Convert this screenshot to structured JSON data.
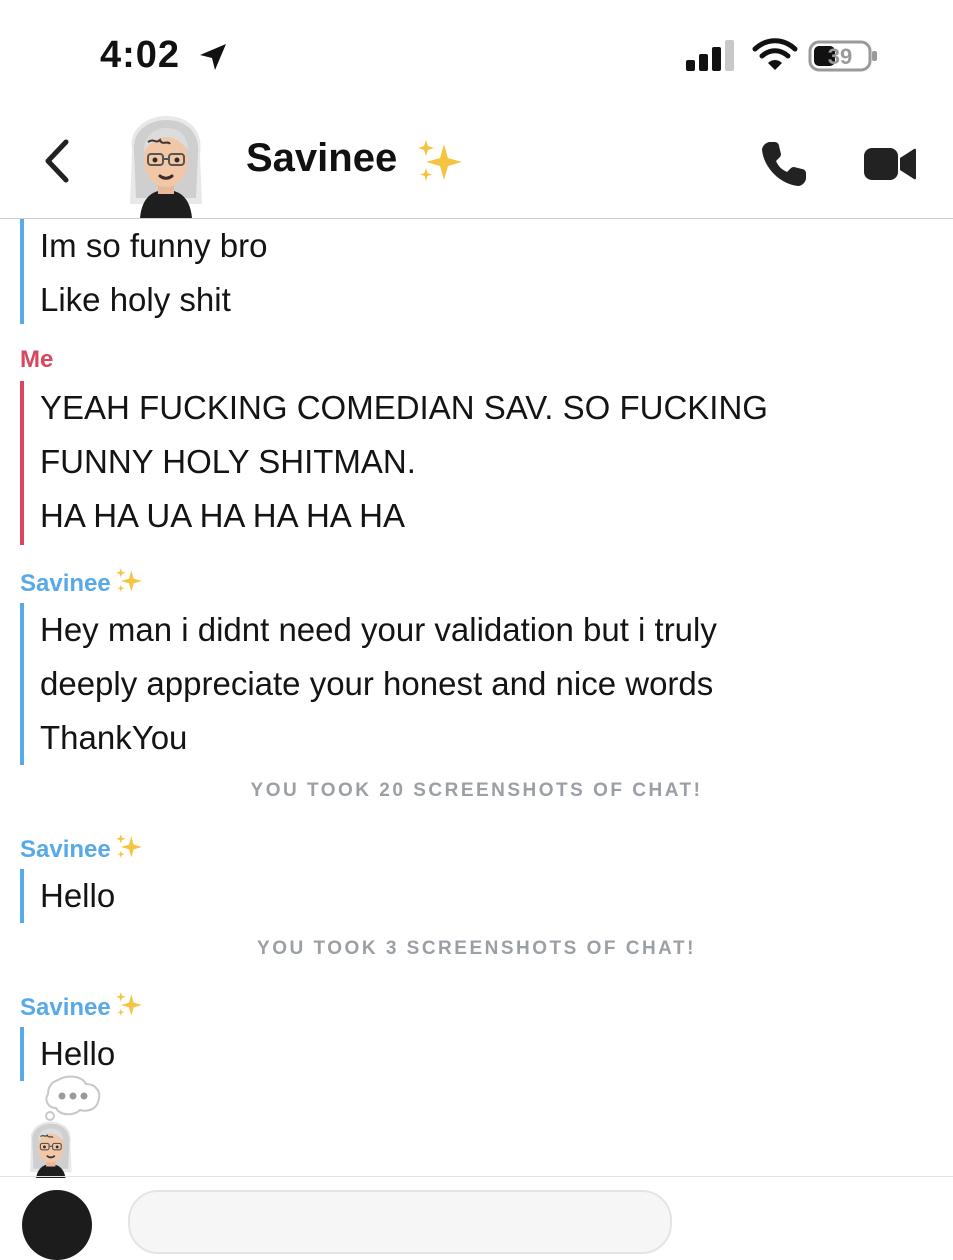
{
  "status_bar": {
    "time": "4:02",
    "battery": "39"
  },
  "header": {
    "contact_name": "Savinee",
    "icons": [
      "back-chevron-icon",
      "avatar",
      "sparkles-icon",
      "phone-icon",
      "video-camera-icon"
    ]
  },
  "chat": {
    "messages": [
      {
        "sender": "",
        "lines": [
          "Im so funny bro",
          "Like holy shit"
        ]
      },
      {
        "sender": "Me",
        "lines": [
          "YEAH FUCKING COMEDIAN SAV. SO FUCKING",
          "FUNNY HOLY SHITMAN.",
          "HA HA UA HA HA HA HA"
        ]
      },
      {
        "sender": "Savinee",
        "lines": [
          "Hey man i didnt need your validation but i truly",
          "deeply appreciate your honest and nice words",
          "ThankYou"
        ]
      },
      {
        "sender": "Savinee",
        "lines": [
          "Hello"
        ]
      },
      {
        "sender": "Savinee",
        "lines": [
          "Hello"
        ]
      }
    ],
    "notices": [
      "YOU TOOK 20 SCREENSHOTS OF CHAT!",
      "YOU TOOK 3 SCREENSHOTS OF CHAT!"
    ]
  },
  "colors": {
    "friend": "#58a9e8",
    "me": "#d9465e",
    "notice": "#9aa0a6"
  }
}
